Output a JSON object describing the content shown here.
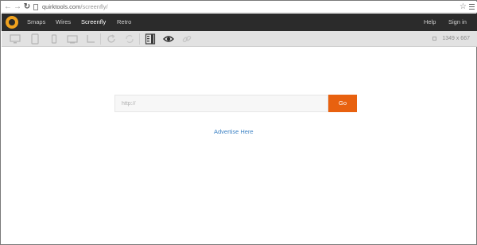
{
  "browser": {
    "url_host": "quirktools.com",
    "url_path": "/screenfly/"
  },
  "app": {
    "logo_icon": "quirktools-logo",
    "accent_color": "#e8610f",
    "nav": [
      {
        "label": "Smaps",
        "active": false
      },
      {
        "label": "Wires",
        "active": false
      },
      {
        "label": "Screenfly",
        "active": true
      },
      {
        "label": "Retro",
        "active": false
      }
    ],
    "right_nav": [
      {
        "label": "Help"
      },
      {
        "label": "Sign in"
      }
    ]
  },
  "toolbar": {
    "tools": [
      "desktop-icon",
      "tablet-icon",
      "phone-icon",
      "television-icon",
      "custom-size-icon",
      "rotate-icon",
      "refresh-icon",
      "scrollbar-icon",
      "preview-eye-icon",
      "share-link-icon"
    ],
    "resolution": "1349 x 667"
  },
  "main": {
    "url_placeholder": "http://",
    "go_label": "Go",
    "advertise_label": "Advertise Here"
  }
}
